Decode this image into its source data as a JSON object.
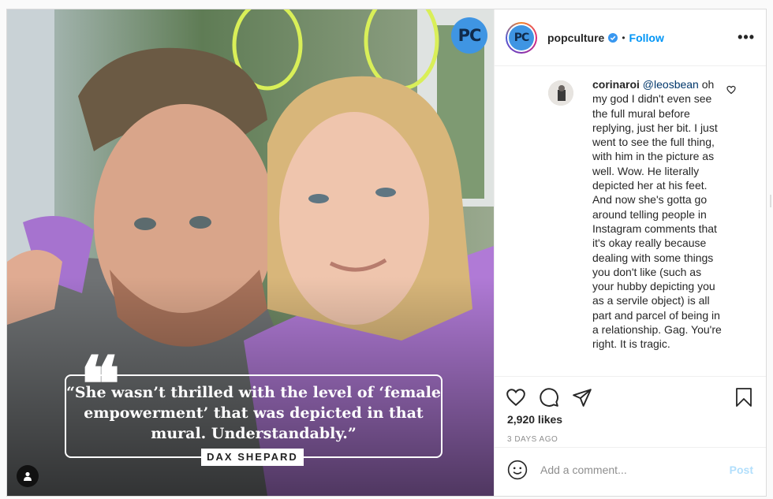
{
  "photo": {
    "watermark": "PC",
    "quote": "“She wasn’t thrilled with the level of ‘female empowerment’ that was depicted in that mural. Understandably.”",
    "quote_mark": "❝",
    "author": "DAX SHEPARD",
    "tag_icon": "user-tag-icon"
  },
  "header": {
    "avatar_text": "PC",
    "username": "popculture",
    "separator": "•",
    "follow_label": "Follow",
    "more_label": "•••"
  },
  "comment": {
    "user": "corinaroi",
    "mention": "@leosbean",
    "text": " oh my god I didn't even see the full mural before replying, just her bit. I just went to see the full thing, with him in the picture as well. Wow. He literally depicted her at his feet. And now she's gotta go around telling people in Instagram comments that it's okay really because dealing with some things you don't like (such as your hubby depicting you as a servile object) is all part and parcel of being in a relationship. Gag. You're right. It is tragic."
  },
  "actions": {
    "likes": "2,920 likes",
    "time_ago": "3 DAYS AGO"
  },
  "add_comment": {
    "placeholder": "Add a comment...",
    "post_label": "Post"
  },
  "colors": {
    "accent": "#0095f6",
    "post_disabled": "#b2dffc",
    "pc_brand": "#3f95e3",
    "sweater": "#b07ad6"
  }
}
